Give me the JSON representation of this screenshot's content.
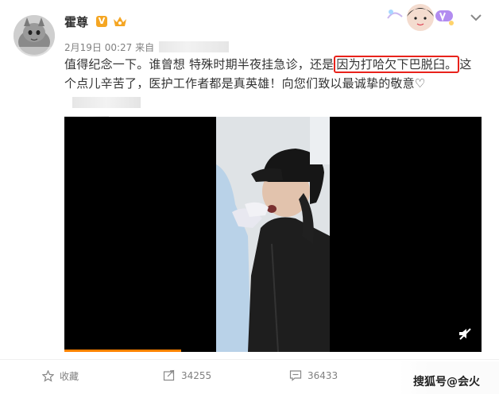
{
  "post": {
    "username": "霍尊",
    "verified_mark": "V",
    "timestamp": "2月19日 00:27",
    "source_prefix": "来自",
    "text_before": "值得纪念一下。谁曾想 特殊时期半夜挂急诊，还是",
    "text_highlight": "因为打哈欠下巴脱臼。",
    "text_after": "这个点儿辛苦了，医护工作者都是真英雄！向您们致以最诚挚的敬意♡"
  },
  "video": {
    "progress_fraction": 0.28
  },
  "actions": {
    "favorite_label": "收藏",
    "repost_count": "34255",
    "comment_count": "36433"
  },
  "watermark": "搜狐号@会火",
  "colors": {
    "highlight_border": "#e8221b",
    "progress": "#ff8200",
    "verified": "#f5a623"
  }
}
